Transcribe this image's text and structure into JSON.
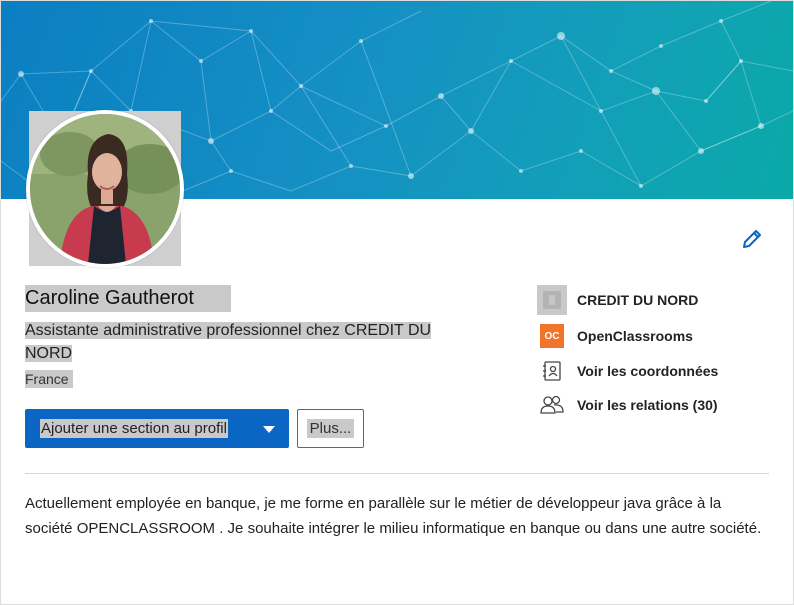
{
  "profile": {
    "name": "Caroline Gautherot",
    "headline": "Assistante administrative professionnel chez CREDIT DU NORD",
    "location": "France",
    "summary": "Actuellement employée en banque, je me forme en parallèle sur le métier de développeur java grâce à la société OPENCLASSROOM . Je souhaite intégrer le milieu informatique en banque ou dans une autre société."
  },
  "actions": {
    "add_section_label": "Ajouter une section au profil",
    "more_label": "Plus..."
  },
  "sidebar": {
    "items": [
      {
        "label": "CREDIT DU NORD",
        "icon": "company-logo-icon"
      },
      {
        "label": "OpenClassrooms",
        "icon": "openclassrooms-logo-icon"
      },
      {
        "label": "Voir les coordonnées",
        "icon": "contact-card-icon"
      },
      {
        "label": "Voir les relations (30)",
        "icon": "people-icon"
      }
    ]
  },
  "openclassrooms_logo_text": "OC",
  "colors": {
    "accent": "#0a66c2",
    "banner_start": "#0a7fc2",
    "banner_end": "#0aa9a8",
    "openclassrooms": "#f2732a"
  }
}
